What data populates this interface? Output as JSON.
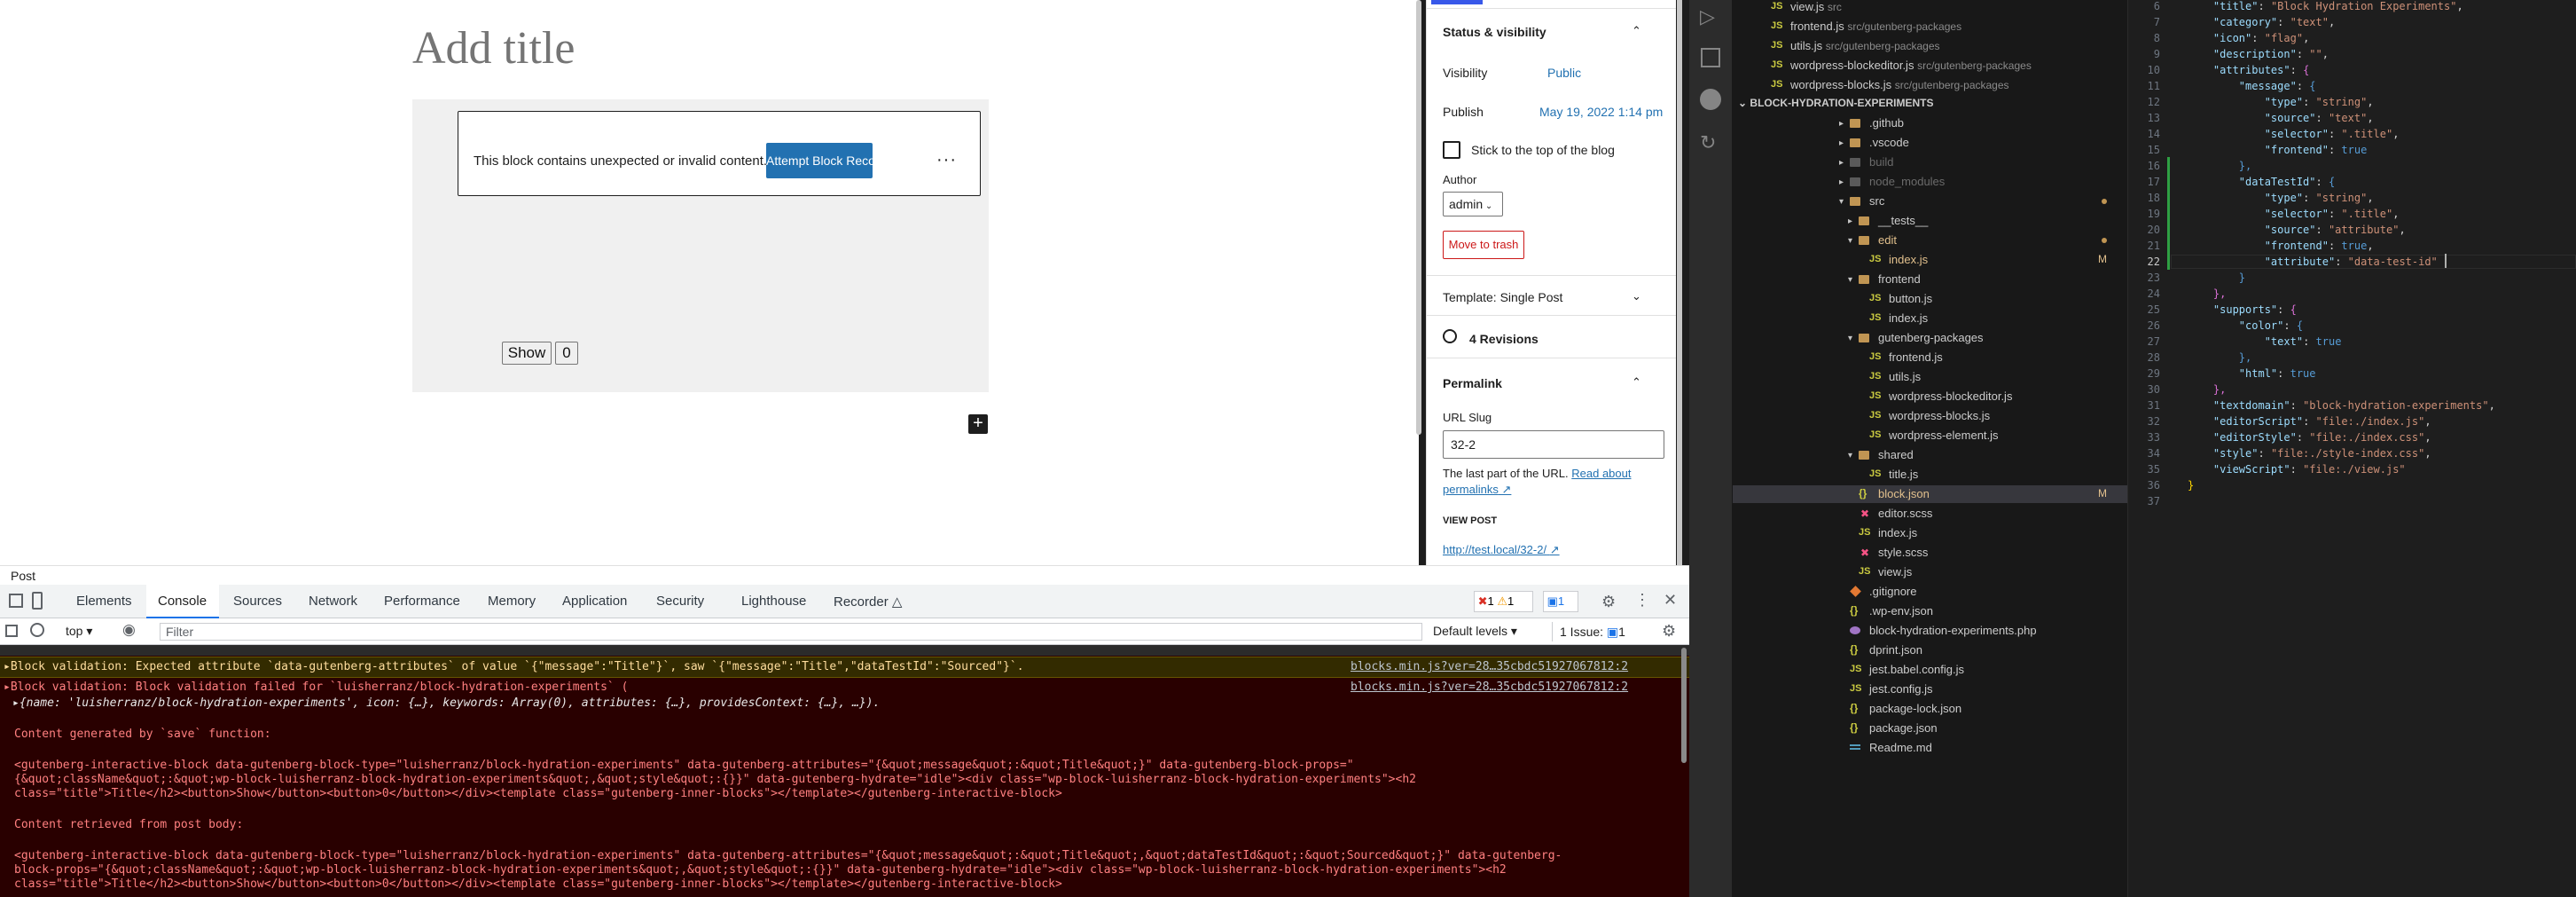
{
  "editor": {
    "title_placeholder": "Add title",
    "invalid_message": "This block contains unexpected or invalid content.",
    "recovery_button": "Attempt Block Recovery",
    "more_dots": "⋮",
    "show_button": "Show",
    "count_value": "0",
    "inserter_glyph": "+"
  },
  "sidebar": {
    "status_heading": "Status & visibility",
    "visibility_label": "Visibility",
    "visibility_value": "Public",
    "publish_label": "Publish",
    "publish_value": "May 19, 2022 1:14 pm",
    "sticky_label": "Stick to the top of the blog",
    "author_label": "Author",
    "author_value": "admin",
    "trash_button": "Move to trash",
    "template_label": "Template: Single Post",
    "revisions_label": "4 Revisions",
    "permalink_heading": "Permalink",
    "url_slug_label": "URL Slug",
    "url_slug_value": "32-2",
    "permalink_help": "The last part of the URL.",
    "read_about": "Read about",
    "permalinks_word": "permalinks",
    "view_post_label": "VIEW POST",
    "view_post_link": "http://test.local/32-2/"
  },
  "footer": {
    "breadcrumb": "Post"
  },
  "devtools": {
    "tabs": [
      "Elements",
      "Console",
      "Sources",
      "Network",
      "Performance",
      "Memory",
      "Application",
      "Security",
      "Lighthouse",
      "Recorder"
    ],
    "error_count": "1",
    "warn_count": "1",
    "msg_count": "1",
    "context": "top",
    "filter_placeholder": "Filter",
    "levels": "Default levels",
    "issues_label": "1 Issue:",
    "issues_count": "1",
    "console_lines": {
      "warn": "▸Block validation: Expected attribute `data-gutenberg-attributes` of value `{\"message\":\"Title\"}`, saw `{\"message\":\"Title\",\"dataTestId\":\"Sourced\"}`.",
      "warn_src": "blocks.min.js?ver=28…35cbdc51927067812:2",
      "err1": "▸Block validation: Block validation failed for `luisherranz/block-hydration-experiments` (",
      "err1_src": "blocks.min.js?ver=28…35cbdc51927067812:2",
      "err2": "▸{name: 'luisherranz/block-hydration-experiments', icon: {…}, keywords: Array(0), attributes: {…}, providesContext: {…}, …}).",
      "save_heading": "Content generated by `save` function:",
      "save_1": "<gutenberg-interactive-block data-gutenberg-block-type=\"luisherranz/block-hydration-experiments\" data-gutenberg-attributes=\"{&quot;message&quot;:&quot;Title&quot;}\" data-gutenberg-block-props=\"",
      "save_2": "{&quot;className&quot;:&quot;wp-block-luisherranz-block-hydration-experiments&quot;,&quot;style&quot;:{}}\" data-gutenberg-hydrate=\"idle\"><div class=\"wp-block-luisherranz-block-hydration-experiments\"><h2",
      "save_3": "class=\"title\">Title</h2><button>Show</button><button>0</button></div><template class=\"gutenberg-inner-blocks\"></template></gutenberg-interactive-block>",
      "post_heading": "Content retrieved from post body:",
      "post_1": "<gutenberg-interactive-block data-gutenberg-block-type=\"luisherranz/block-hydration-experiments\" data-gutenberg-attributes=\"{&quot;message&quot;:&quot;Title&quot;,&quot;dataTestId&quot;:&quot;Sourced&quot;}\" data-gutenberg-",
      "post_2": "block-props=\"{&quot;className&quot;:&quot;wp-block-luisherranz-block-hydration-experiments&quot;,&quot;style&quot;:{}}\" data-gutenberg-hydrate=\"idle\"><div class=\"wp-block-luisherranz-block-hydration-experiments\"><h2",
      "post_3": "class=\"title\">Title</h2><button>Show</button><button>0</button></div><template class=\"gutenberg-inner-blocks\"></template></gutenberg-interactive-block>"
    }
  },
  "explorer": {
    "project_header": "BLOCK-HYDRATION-EXPERIMENTS",
    "top_files": [
      {
        "name": "view.js",
        "desc": "src"
      },
      {
        "name": "frontend.js",
        "desc": "src/gutenberg-packages"
      },
      {
        "name": "utils.js",
        "desc": "src/gutenberg-packages"
      },
      {
        "name": "wordpress-blockeditor.js",
        "desc": "src/gutenberg-packages"
      },
      {
        "name": "wordpress-blocks.js",
        "desc": "src/gutenberg-packages"
      }
    ],
    "tree": [
      {
        "name": ".github"
      },
      {
        "name": ".vscode"
      },
      {
        "name": "build"
      },
      {
        "name": "node_modules"
      },
      {
        "name": "src"
      },
      {
        "name": "__tests__"
      },
      {
        "name": "edit"
      },
      {
        "name": "index.js",
        "badge": "M"
      },
      {
        "name": "frontend"
      },
      {
        "name": "button.js"
      },
      {
        "name": "index.js"
      },
      {
        "name": "gutenberg-packages"
      },
      {
        "name": "frontend.js"
      },
      {
        "name": "utils.js"
      },
      {
        "name": "wordpress-blockeditor.js"
      },
      {
        "name": "wordpress-blocks.js"
      },
      {
        "name": "wordpress-element.js"
      },
      {
        "name": "shared"
      },
      {
        "name": "title.js"
      },
      {
        "name": "block.json",
        "badge": "M"
      },
      {
        "name": "editor.scss"
      },
      {
        "name": "index.js"
      },
      {
        "name": "style.scss"
      },
      {
        "name": "view.js"
      },
      {
        "name": ".gitignore"
      },
      {
        "name": ".wp-env.json"
      },
      {
        "name": "block-hydration-experiments.php"
      },
      {
        "name": "dprint.json"
      },
      {
        "name": "jest.babel.config.js"
      },
      {
        "name": "jest.config.js"
      },
      {
        "name": "package-lock.json"
      },
      {
        "name": "package.json"
      },
      {
        "name": "Readme.md"
      }
    ]
  },
  "code": {
    "line_numbers": [
      "6",
      "7",
      "8",
      "9",
      "10",
      "11",
      "12",
      "13",
      "14",
      "15",
      "16",
      "17",
      "18",
      "19",
      "20",
      "21",
      "22",
      "23",
      "24",
      "25",
      "26",
      "27",
      "28",
      "29",
      "30",
      "31",
      "32",
      "33",
      "34",
      "35",
      "36",
      "37"
    ],
    "l6_key": "\"title\"",
    "l6_val": "\"Block Hydration Experiments\"",
    "l7_key": "\"category\"",
    "l7_val": "\"text\"",
    "l8_key": "\"icon\"",
    "l8_val": "\"flag\"",
    "l9_key": "\"description\"",
    "l9_val": "\"\"",
    "l10_key": "\"attributes\"",
    "l11_key": "\"message\"",
    "l12_key": "\"type\"",
    "l12_val": "\"string\"",
    "l13_key": "\"source\"",
    "l13_val": "\"text\"",
    "l14_key": "\"selector\"",
    "l14_val": "\".title\"",
    "l15_key": "\"frontend\"",
    "l15_val": "true",
    "l17_key": "\"dataTestId\"",
    "l18_key": "\"type\"",
    "l18_val": "\"string\"",
    "l19_key": "\"selector\"",
    "l19_val": "\".title\"",
    "l20_key": "\"source\"",
    "l20_val": "\"attribute\"",
    "l21_key": "\"frontend\"",
    "l21_val": "true",
    "l22_key": "\"attribute\"",
    "l22_val": "\"data-test-id\"",
    "l25_key": "\"supports\"",
    "l26_key": "\"color\"",
    "l27_key": "\"text\"",
    "l27_val": "true",
    "l29_key": "\"html\"",
    "l29_val": "true",
    "l31_key": "\"textdomain\"",
    "l31_val": "\"block-hydration-experiments\"",
    "l32_key": "\"editorScript\"",
    "l32_val": "\"file:./index.js\"",
    "l33_key": "\"editorStyle\"",
    "l33_val": "\"file:./index.css\"",
    "l34_key": "\"style\"",
    "l34_val": "\"file:./style-index.css\"",
    "l35_key": "\"viewScript\"",
    "l35_val": "\"file:./view.js\""
  },
  "colors": {
    "wp_accent": "#2271b1",
    "trash_red": "#cc1818",
    "console_error_bg": "#290000",
    "console_warn_bg": "#332b00",
    "vscode_bg": "#1e1e1e",
    "json_key": "#9cdcfe",
    "json_string": "#ce9178"
  }
}
